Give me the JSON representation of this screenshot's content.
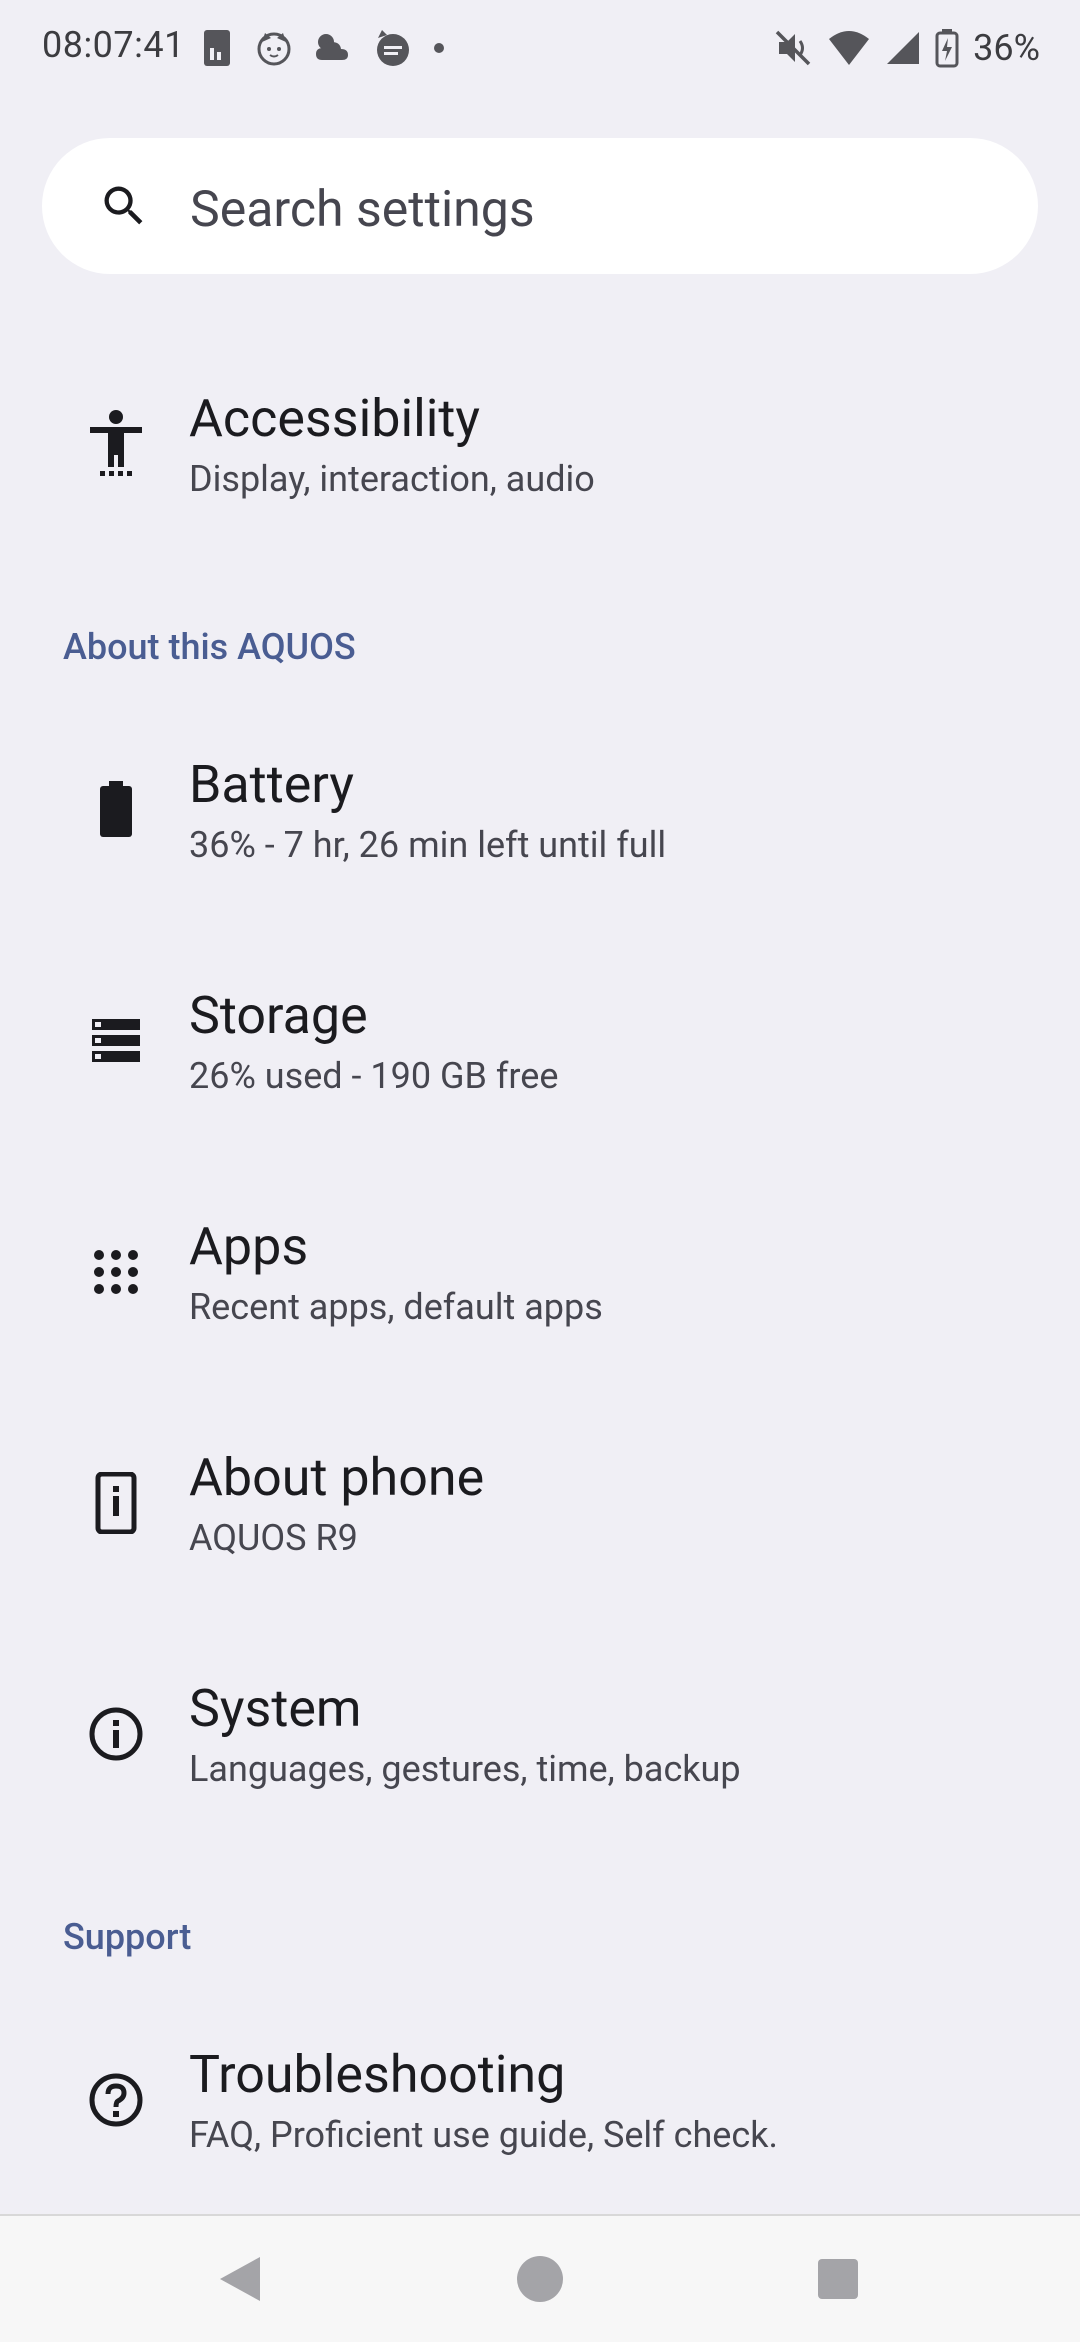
{
  "status_bar": {
    "time": "08:07:41",
    "battery_percent": "36%",
    "left_icons": [
      "sim-card-icon",
      "cat-face-icon",
      "weather-icon",
      "app-notification-icon",
      "more-notifications-dot-icon"
    ],
    "right_icons": [
      "vibrate-off-icon",
      "wifi-icon",
      "cellular-signal-icon",
      "battery-charging-icon"
    ]
  },
  "search": {
    "placeholder": "Search settings",
    "icon": "search-icon"
  },
  "items": {
    "accessibility": {
      "title": "Accessibility",
      "subtitle": "Display, interaction, audio",
      "icon": "accessibility-icon"
    },
    "battery": {
      "title": "Battery",
      "subtitle": "36% - 7 hr, 26 min left until full",
      "icon": "battery-icon"
    },
    "storage": {
      "title": "Storage",
      "subtitle": "26% used - 190 GB free",
      "icon": "storage-icon"
    },
    "apps": {
      "title": "Apps",
      "subtitle": "Recent apps, default apps",
      "icon": "apps-grid-icon"
    },
    "about_phone": {
      "title": "About phone",
      "subtitle": "AQUOS R9",
      "icon": "phone-info-icon"
    },
    "system": {
      "title": "System",
      "subtitle": "Languages, gestures, time, backup",
      "icon": "info-icon"
    },
    "troubleshooting": {
      "title": "Troubleshooting",
      "subtitle": "FAQ, Proficient use guide, Self check.",
      "icon": "help-icon"
    }
  },
  "sections": {
    "about": "About this AQUOS",
    "support": "Support"
  },
  "nav_bar": {
    "buttons": [
      "back-icon",
      "home-icon",
      "recents-icon"
    ]
  },
  "colors": {
    "background": "#f0eff5",
    "section_header": "#4a5d92",
    "search_background": "#ffffff"
  }
}
